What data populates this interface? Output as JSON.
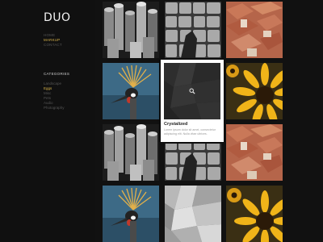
{
  "site": {
    "logo": "DUO"
  },
  "nav": {
    "items": [
      {
        "label": "HOME",
        "active": false
      },
      {
        "label": "MARKUP",
        "active": true
      },
      {
        "label": "CONTACT",
        "active": false
      }
    ]
  },
  "categories": {
    "heading": "CATEGORIES",
    "items": [
      {
        "label": "Landscape",
        "active": false
      },
      {
        "label": "Eggs",
        "active": true
      },
      {
        "label": "Misc",
        "active": false
      },
      {
        "label": "Pets",
        "active": false
      },
      {
        "label": "Audio",
        "active": false
      },
      {
        "label": "Photography",
        "active": false
      }
    ]
  },
  "popover": {
    "title": "Crystalized",
    "description": "Lorem ipsum dolor sit amet, consectetur adipiscing elit. Nulla vitae ultrices."
  },
  "gallery": {
    "tiles": [
      {
        "image": "wooden-posts"
      },
      {
        "image": "cobblestones"
      },
      {
        "image": "rooftops"
      },
      {
        "image": "crowned-crane"
      },
      {
        "image": "crystal"
      },
      {
        "image": "sunflower"
      },
      {
        "image": "wooden-posts"
      },
      {
        "image": "cobblestones"
      },
      {
        "image": "rooftops"
      },
      {
        "image": "crowned-crane"
      },
      {
        "image": "crystal"
      },
      {
        "image": "sunflower"
      }
    ]
  }
}
